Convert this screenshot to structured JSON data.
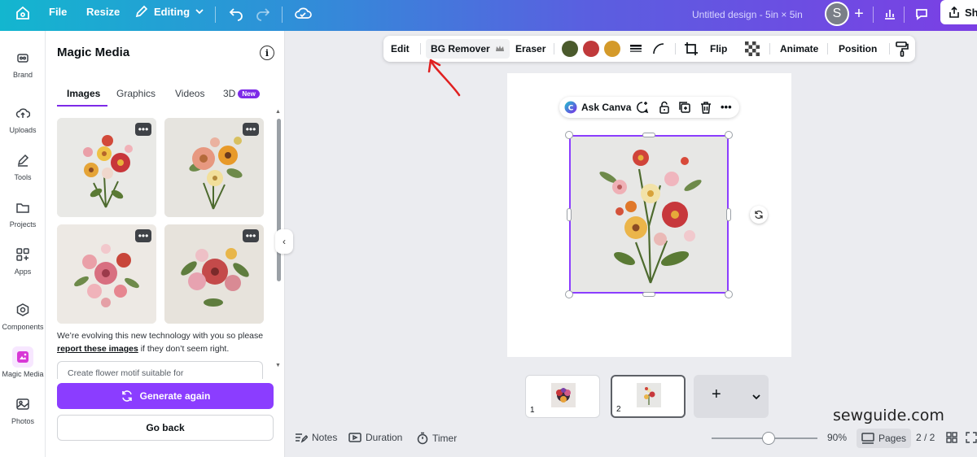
{
  "topbar": {
    "file_label": "File",
    "resize_label": "Resize",
    "editing_label": "Editing",
    "design_title": "Untitled design - 5in × 5in",
    "avatar_letter": "S",
    "share_label": "Sh"
  },
  "rail": {
    "items": [
      {
        "label": "Brand",
        "icon": "crown-icon"
      },
      {
        "label": "Uploads",
        "icon": "upload-cloud-icon"
      },
      {
        "label": "Tools",
        "icon": "pen-icon"
      },
      {
        "label": "Projects",
        "icon": "folder-icon"
      },
      {
        "label": "Apps",
        "icon": "apps-icon"
      },
      {
        "label": "Components",
        "icon": "components-icon"
      },
      {
        "label": "Magic Media",
        "icon": "magic-media-icon"
      },
      {
        "label": "Photos",
        "icon": "photo-icon"
      }
    ]
  },
  "panel": {
    "title": "Magic Media",
    "tabs": [
      "Images",
      "Graphics",
      "Videos",
      "3D"
    ],
    "new_badge": "New",
    "disclaimer_pre": "We’re evolving this new technology with you so please ",
    "disclaimer_link": "report these images",
    "disclaimer_post": " if they don’t seem right.",
    "prompt_text": "Create flower motif suitable for",
    "generate_label": "Generate again",
    "goback_label": "Go back"
  },
  "toolbar": {
    "edit": "Edit",
    "bg_remover": "BG Remover",
    "eraser": "Eraser",
    "flip": "Flip",
    "animate": "Animate",
    "position": "Position",
    "swatches": [
      "#4a5a2c",
      "#c0393b",
      "#d49a2a"
    ]
  },
  "ask_canva": {
    "label": "Ask Canva"
  },
  "pages": {
    "items": [
      {
        "num": "1"
      },
      {
        "num": "2"
      }
    ],
    "add_symbol": "+"
  },
  "watermark": "sewguide.com",
  "bottombar": {
    "notes": "Notes",
    "duration": "Duration",
    "timer": "Timer",
    "zoom": "90%",
    "pages_label": "Pages",
    "page_count": "2 / 2"
  }
}
